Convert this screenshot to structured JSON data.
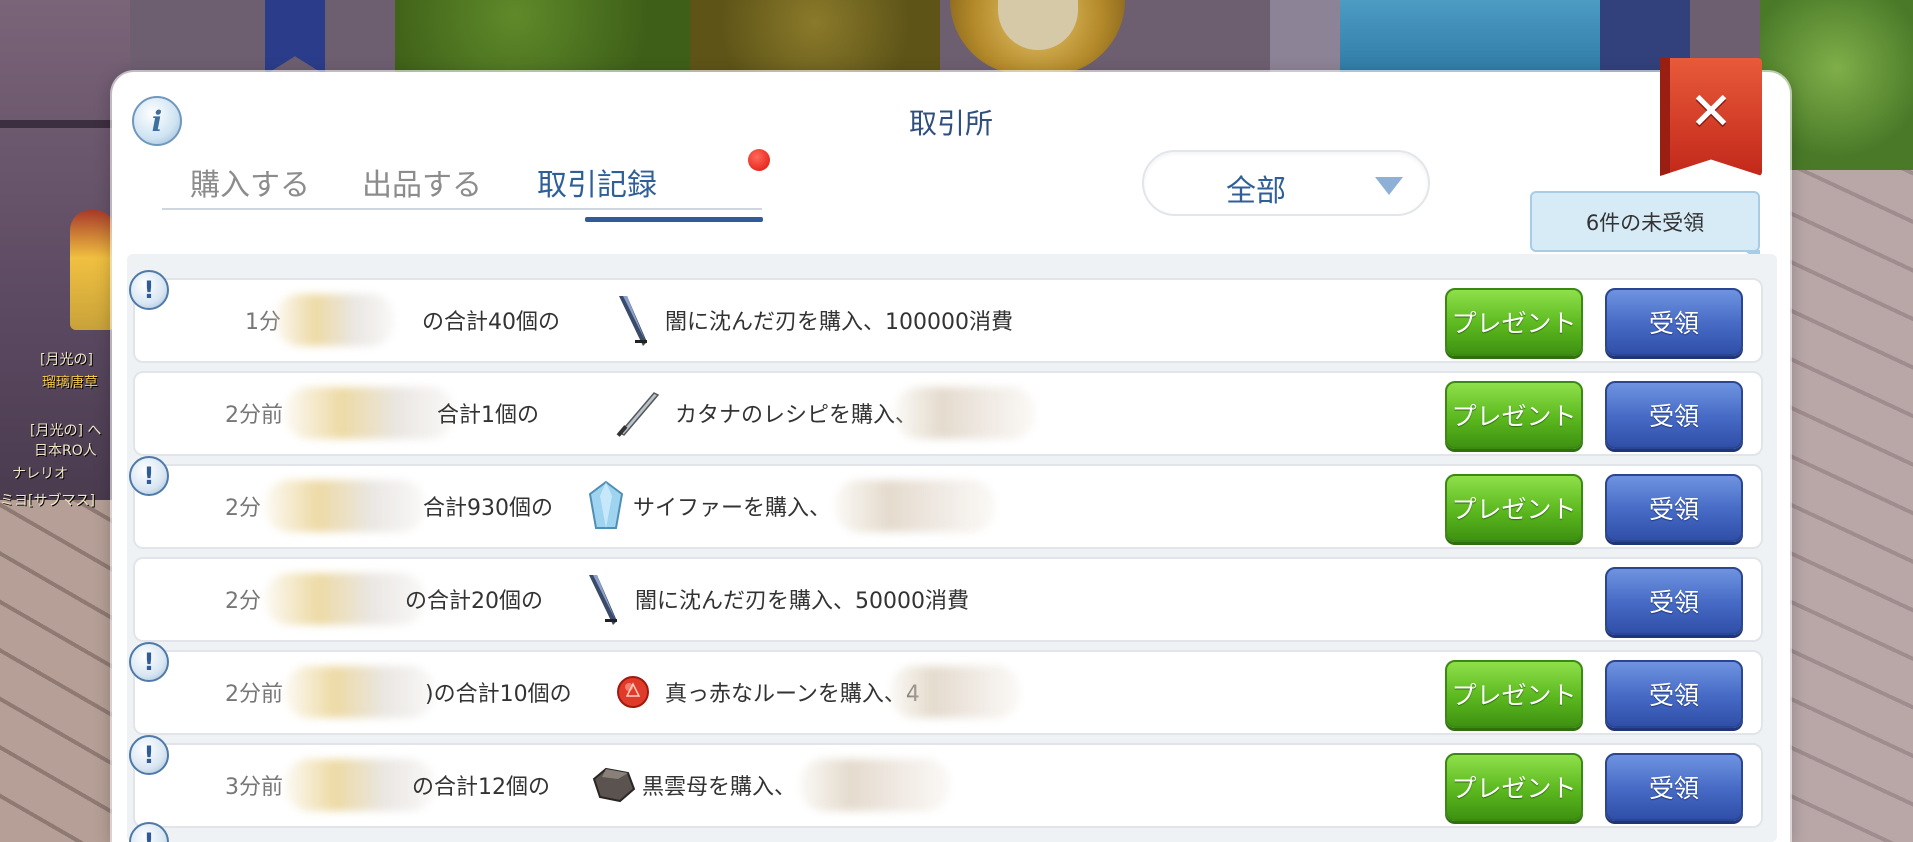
{
  "background": {
    "nameplates": [
      "[月光の]",
      "瑠璃唐草",
      "[月光の] へ",
      "日本RO人",
      "ナレリオ",
      "ミヨ[サブマス]"
    ]
  },
  "dialog": {
    "title": "取引所",
    "info_symbol": "i",
    "close_symbol": "✕",
    "tabs": [
      {
        "label": "購入する",
        "active": false
      },
      {
        "label": "出品する",
        "active": false
      },
      {
        "label": "取引記録",
        "active": true
      }
    ],
    "filter": {
      "value": "全部"
    },
    "unclaimed_label": "6件の未受領",
    "buttons": {
      "present": "プレゼント",
      "claim": "受領"
    },
    "alert_symbol": "!",
    "records": [
      {
        "time": "1分",
        "qty": "の合計40個の",
        "desc": "闇に沈んだ刃を購入、100000消費",
        "icon": "dark-blade-icon",
        "has_present": true,
        "has_alert": true
      },
      {
        "time": "2分前",
        "qty": "合計1個の",
        "desc": "カタナのレシピを購入、",
        "icon": "katana-icon",
        "has_present": true,
        "has_alert": false
      },
      {
        "time": "2分",
        "qty": "合計930個の",
        "desc": "サイファーを購入、",
        "icon": "crystal-icon",
        "has_present": true,
        "has_alert": true
      },
      {
        "time": "2分",
        "qty": "の合計20個の",
        "desc": "闇に沈んだ刃を購入、50000消費",
        "icon": "dark-blade-icon",
        "has_present": false,
        "has_alert": false
      },
      {
        "time": "2分前",
        "qty": ")の合計10個の",
        "desc": "真っ赤なルーンを購入、4",
        "icon": "red-rune-icon",
        "has_present": true,
        "has_alert": true
      },
      {
        "time": "3分前",
        "qty": "の合計12個の",
        "desc": "黒雲母を購入、",
        "icon": "black-mica-icon",
        "has_present": true,
        "has_alert": true
      }
    ]
  }
}
